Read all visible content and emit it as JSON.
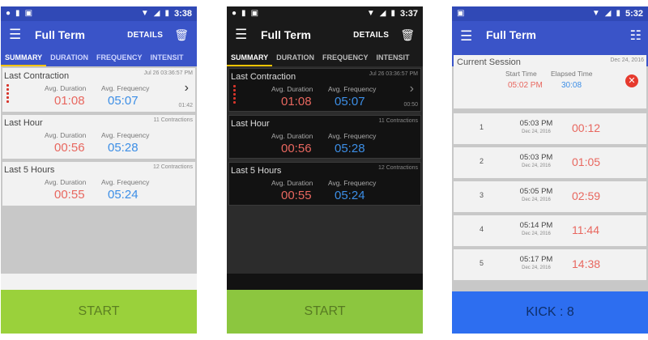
{
  "screens": [
    {
      "status_time": "3:38",
      "app_title": "Full Term",
      "details_label": "DETAILS",
      "tabs": [
        "SUMMARY",
        "DURATION",
        "FREQUENCY",
        "INTENSIT"
      ],
      "active_tab": 0,
      "cards": [
        {
          "title": "Last Contraction",
          "right_top": "Jul 26 03:36:57 PM",
          "dur_label": "Avg. Duration",
          "freq_label": "Avg. Frequency",
          "duration": "01:08",
          "frequency": "05:07",
          "bottom_right": "01:42"
        },
        {
          "title": "Last Hour",
          "right_top": "11 Contractions",
          "dur_label": "Avg. Duration",
          "freq_label": "Avg. Frequency",
          "duration": "00:56",
          "frequency": "05:28"
        },
        {
          "title": "Last 5 Hours",
          "right_top": "12 Contractions",
          "dur_label": "Avg. Duration",
          "freq_label": "Avg. Frequency",
          "duration": "00:55",
          "frequency": "05:24"
        }
      ],
      "start_label": "START"
    },
    {
      "status_time": "3:37",
      "app_title": "Full Term",
      "details_label": "DETAILS",
      "tabs": [
        "SUMMARY",
        "DURATION",
        "FREQUENCY",
        "INTENSIT"
      ],
      "active_tab": 0,
      "cards": [
        {
          "title": "Last Contraction",
          "right_top": "Jul 26 03:36:57 PM",
          "dur_label": "Avg. Duration",
          "freq_label": "Avg. Frequency",
          "duration": "01:08",
          "frequency": "05:07",
          "bottom_right": "00:50"
        },
        {
          "title": "Last Hour",
          "right_top": "11 Contractions",
          "dur_label": "Avg. Duration",
          "freq_label": "Avg. Frequency",
          "duration": "00:56",
          "frequency": "05:28"
        },
        {
          "title": "Last 5 Hours",
          "right_top": "12 Contractions",
          "dur_label": "Avg. Duration",
          "freq_label": "Avg. Frequency",
          "duration": "00:55",
          "frequency": "05:24"
        }
      ],
      "start_label": "START"
    },
    {
      "status_time": "5:32",
      "app_title": "Full Term",
      "session": {
        "title": "Current Session",
        "date": "Dec 24, 2016",
        "start_label": "Start Time",
        "elapsed_label": "Elapsed Time",
        "start_value": "05:02 PM",
        "elapsed_value": "30:08"
      },
      "kicks": [
        {
          "num": "1",
          "time": "05:03 PM",
          "date": "Dec 24, 2016",
          "elapsed": "00:12"
        },
        {
          "num": "2",
          "time": "05:03 PM",
          "date": "Dec 24, 2016",
          "elapsed": "01:05"
        },
        {
          "num": "3",
          "time": "05:05 PM",
          "date": "Dec 24, 2016",
          "elapsed": "02:59"
        },
        {
          "num": "4",
          "time": "05:14 PM",
          "date": "Dec 24, 2016",
          "elapsed": "11:44"
        },
        {
          "num": "5",
          "time": "05:17 PM",
          "date": "Dec 24, 2016",
          "elapsed": "14:38"
        }
      ],
      "kick_label": "KICK : 8"
    }
  ],
  "icons": {
    "menu": "hamburger-icon",
    "trash": "trash-icon",
    "list": "list-icon",
    "close": "close-icon",
    "chevron": "chevron-right-icon"
  },
  "colors": {
    "appbar_blue": "#3a54c8",
    "duration_red": "#e8675f",
    "frequency_blue": "#3c8ee6",
    "start_green": "#9ad13b",
    "kick_blue": "#2d6ef0",
    "close_red": "#e63a2e",
    "tab_indicator": "#f5c400"
  }
}
